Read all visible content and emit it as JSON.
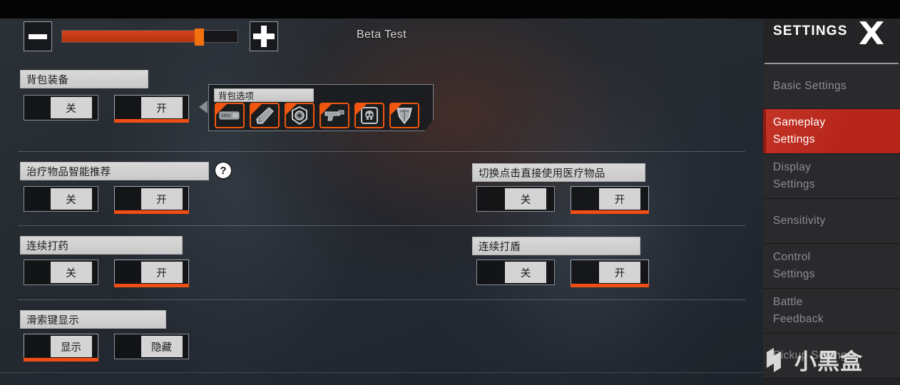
{
  "header": {
    "beta_test_label": "Beta Test"
  },
  "slider": {
    "minus_label": "minus-icon",
    "plus_label": "plus-icon",
    "fill_percent": 78
  },
  "sidebar": {
    "title": "SETTINGS",
    "close_icon": "close-x-icon",
    "items": [
      {
        "label": "Basic Settings",
        "line1": "Basic Settings",
        "line2": "",
        "active": false
      },
      {
        "label": "Gameplay Settings",
        "line1": "Gameplay",
        "line2": "Settings",
        "active": true
      },
      {
        "label": "Display Settings",
        "line1": "Display",
        "line2": "Settings",
        "active": false
      },
      {
        "label": "Sensitivity",
        "line1": "Sensitivity",
        "line2": "",
        "active": false
      },
      {
        "label": "Control Settings",
        "line1": "Control",
        "line2": "Settings",
        "active": false
      },
      {
        "label": "Battle Feedback",
        "line1": "Battle",
        "line2": "Feedback",
        "active": false
      },
      {
        "label": "Pickup Settings",
        "line1": "Pickup Settings",
        "line2": "",
        "active": false
      }
    ]
  },
  "options": {
    "backpack_gear": {
      "label": "背包装备",
      "off_label": "关",
      "on_label": "开",
      "selected": "on"
    },
    "smart_heal_recommend": {
      "label": "治疗物品智能推荐",
      "help_label": "?",
      "off_label": "关",
      "on_label": "开",
      "selected": "on"
    },
    "tap_to_use_heal": {
      "label": "切换点击直接使用医疗物品",
      "off_label": "关",
      "on_label": "开",
      "selected": "on"
    },
    "continuous_heal": {
      "label": "连续打药",
      "off_label": "关",
      "on_label": "开",
      "selected": "on"
    },
    "continuous_shield": {
      "label": "连续打盾",
      "off_label": "关",
      "on_label": "开",
      "selected": "on"
    },
    "zipline_key_display": {
      "label": "滑索键显示",
      "show_label": "显示",
      "hide_label": "隐藏",
      "selected": "show"
    }
  },
  "backpack_flyout": {
    "title": "背包选项",
    "icons": [
      {
        "name": "ammo-magazine-icon",
        "selected": true
      },
      {
        "name": "weapon-attachment-icon",
        "selected": true
      },
      {
        "name": "helmet-armor-icon",
        "selected": true
      },
      {
        "name": "pistol-weapon-icon",
        "selected": true
      },
      {
        "name": "death-box-banner-icon",
        "selected": true
      },
      {
        "name": "body-shield-icon",
        "selected": true
      }
    ]
  },
  "watermark": {
    "text": "小黑盒",
    "logo": "xiaoheihe-logo-icon"
  },
  "colors": {
    "accent_orange": "#f24d12",
    "active_red": "#c1281b",
    "label_bg": "#d4d4d4",
    "sidebar_bg": "#2a2a2d"
  }
}
